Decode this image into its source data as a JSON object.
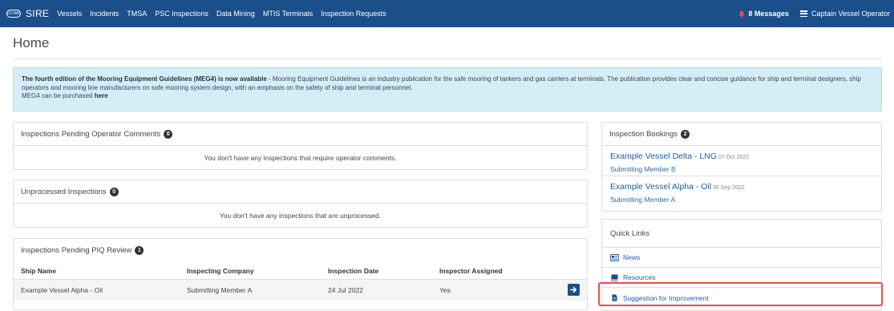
{
  "navbar": {
    "logo_text": "OCIMF",
    "brand": "SIRE",
    "items": [
      "Vessels",
      "Incidents",
      "TMSA",
      "PSC Inspections",
      "Data Mining",
      "MTIS Terminals",
      "Inspection Requests"
    ],
    "messages": "8 Messages",
    "user": "Captain Vessel Operator",
    "colors": {
      "bar": "#1b4f8a",
      "bell": "#e84c4c"
    }
  },
  "page": {
    "title": "Home"
  },
  "alert": {
    "strong": "The fourth edition of the Mooring Equipment Guidelines (MEG4) is now available",
    "body": " - Mooring Equipment Guidelines is an industry publication for the safe mooring of tankers and gas carriers at terminals. The publication provides clear and concise guidance for ship and terminal designers, ship operators and mooring line manufacturers on safe mooring system design, with an emphasis on the safety of ship and terminal personnel.",
    "line2": "MEG4 can be purchased ",
    "link": "here"
  },
  "pending_comments": {
    "title": "Inspections Pending Operator Comments",
    "count": "0",
    "empty": "You don't have any inspections that require operator comments."
  },
  "unprocessed": {
    "title": "Unprocessed Inspections",
    "count": "0",
    "empty": "You don't have any inspections that are unprocessed."
  },
  "piq_review": {
    "title": "Inspections Pending PIQ Review",
    "count": "1",
    "columns": [
      "Ship Name",
      "Inspecting Company",
      "Inspection Date",
      "Inspector Assigned"
    ],
    "rows": [
      {
        "ship": "Example Vessel Alpha - Oil",
        "company": "Submitting Member A",
        "date": "24 Jul 2022",
        "assigned": "Yes"
      }
    ]
  },
  "bookings": {
    "title": "Inspection Bookings",
    "count": "2",
    "items": [
      {
        "vessel": "Example Vessel Delta - LNG",
        "date": "07 Oct 2022",
        "member": "Submitting Member B"
      },
      {
        "vessel": "Example Vessel Alpha - Oil",
        "date": "30 Sep 2022",
        "member": "Submitting Member A"
      }
    ]
  },
  "quick_links": {
    "title": "Quick Links",
    "items": [
      {
        "label": "News",
        "icon": "newspaper-icon"
      },
      {
        "label": "Resources",
        "icon": "book-icon"
      },
      {
        "label": "Suggestion for Improvement",
        "icon": "document-icon"
      }
    ],
    "highlight_color": "#e84c4c"
  }
}
